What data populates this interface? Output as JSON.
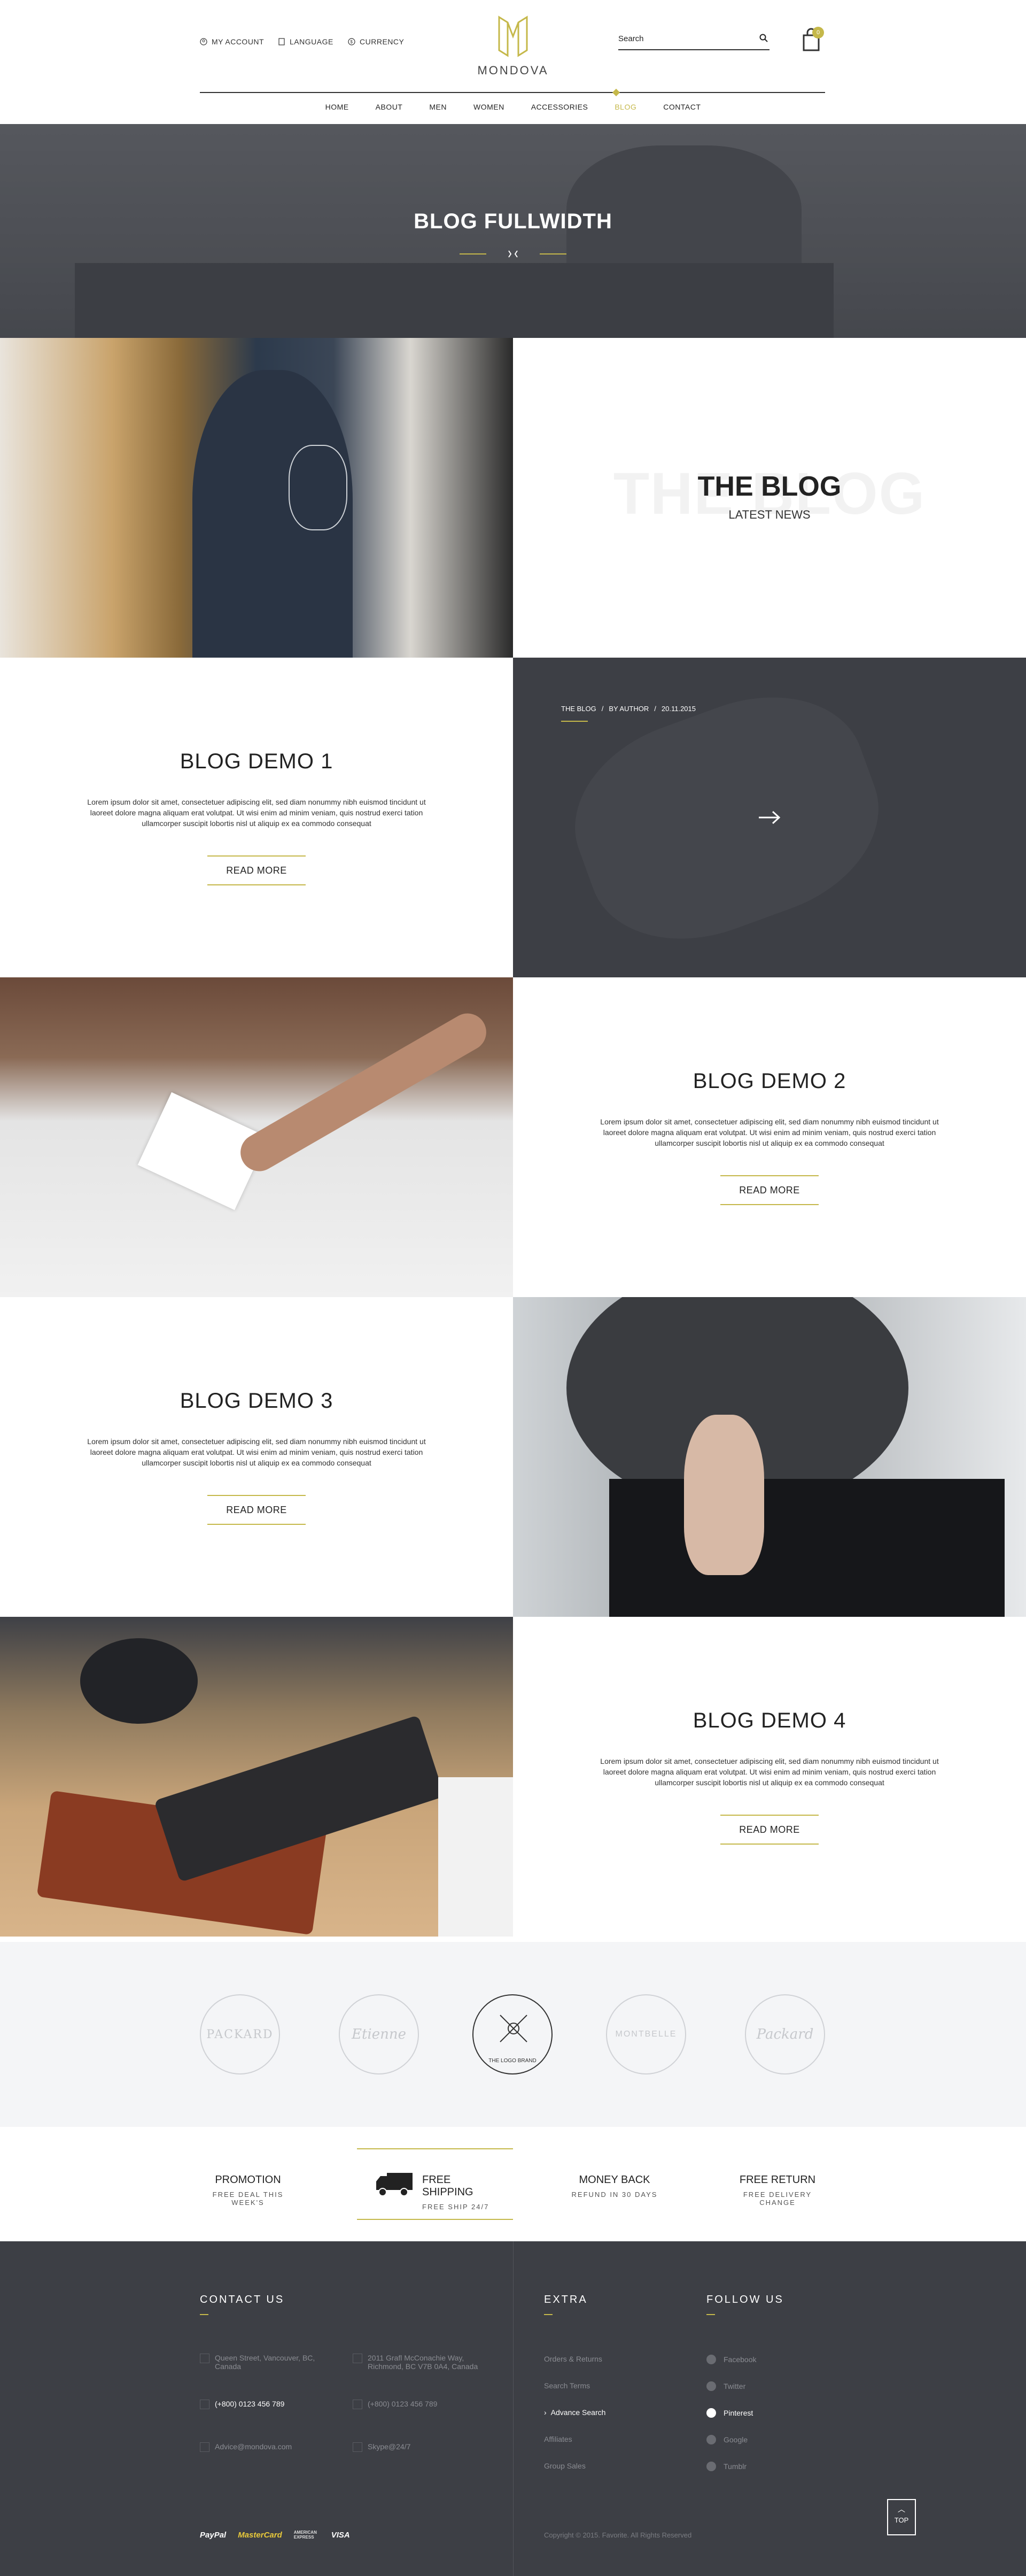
{
  "header": {
    "account": "MY ACCOUNT",
    "language": "LANGUAGE",
    "currency": "CURRENCY",
    "brand": "MONDOVA",
    "search_placeholder": "Search",
    "cart_count": "0",
    "nav": [
      "HOME",
      "ABOUT",
      "MEN",
      "WOMEN",
      "ACCESSORIES",
      "BLOG",
      "CONTACT"
    ],
    "active_nav": "BLOG"
  },
  "hero": {
    "title": "BLOG FULLWIDTH"
  },
  "blog_intro": {
    "bg_text": "THE BLOG",
    "title": "THE BLOG",
    "subtitle": "LATEST NEWS"
  },
  "posts": [
    {
      "title": "BLOG DEMO 1",
      "text": "Lorem ipsum dolor sit amet, consectetuer adipiscing elit, sed diam nonummy nibh euismod tincidunt ut laoreet dolore magna aliquam erat volutpat. Ut wisi enim ad minim veniam, quis nostrud exerci tation ullamcorper suscipit lobortis nisl ut aliquip ex ea commodo consequat",
      "read_more": "READ MORE"
    },
    {
      "title": "BLOG DEMO 2",
      "text": "Lorem ipsum dolor sit amet, consectetuer adipiscing elit, sed diam nonummy nibh euismod tincidunt ut laoreet dolore magna aliquam erat volutpat. Ut wisi enim ad minim veniam, quis nostrud exerci tation ullamcorper suscipit lobortis nisl ut aliquip ex ea commodo consequat",
      "read_more": "READ MORE"
    },
    {
      "title": "BLOG DEMO 3",
      "text": "Lorem ipsum dolor sit amet, consectetuer adipiscing elit, sed diam nonummy nibh euismod tincidunt ut laoreet dolore magna aliquam erat volutpat. Ut wisi enim ad minim veniam, quis nostrud exerci tation ullamcorper suscipit lobortis nisl ut aliquip ex ea commodo consequat",
      "read_more": "READ MORE"
    },
    {
      "title": "BLOG DEMO 4",
      "text": "Lorem ipsum dolor sit amet, consectetuer adipiscing elit, sed diam nonummy nibh euismod tincidunt ut laoreet dolore magna aliquam erat volutpat. Ut wisi enim ad minim veniam, quis nostrud exerci tation ullamcorper suscipit lobortis nisl ut aliquip ex ea commodo consequat",
      "read_more": "READ MORE"
    }
  ],
  "post_meta": {
    "category": "THE BLOG",
    "sep": "/",
    "author": "BY AUTHOR",
    "date": "20.11.2015"
  },
  "brands": [
    "PACKARD",
    "Etienne",
    "THE LOGO BRAND",
    "MONTBELLE",
    "Packard"
  ],
  "features": [
    {
      "title": "PROMOTION",
      "sub": "FREE DEAL THIS WEEK'S"
    },
    {
      "title": "FREE SHIPPING",
      "sub": "FREE SHIP 24/7"
    },
    {
      "title": "MONEY BACK",
      "sub": "REFUND IN 30 DAYS"
    },
    {
      "title": "FREE RETURN",
      "sub": "FREE DELIVERY CHANGE"
    }
  ],
  "footer": {
    "contact_heading": "CONTACT US",
    "address1": "Queen Street, Vancouver, BC, Canada",
    "address2": "2011 Grafl McConachie Way, Richmond, BC V7B 0A4, Canada",
    "phone1": "(+800) 0123 456 789",
    "phone2": "(+800) 0123 456 789",
    "email": "Advice@mondova.com",
    "skype": "Skype@24/7",
    "extra_heading": "EXTRA",
    "extra": [
      "Orders & Returns",
      "Search Terms",
      "Advance Search",
      "Affiliates",
      "Group Sales"
    ],
    "extra_active": "Advance Search",
    "follow_heading": "FOLLOW US",
    "follow": [
      "Facebook",
      "Twitter",
      "Pinterest",
      "Google",
      "Tumblr"
    ],
    "follow_active": "Pinterest",
    "payments": [
      "PayPal",
      "MasterCard",
      "AMERICAN EXPRESS",
      "VISA"
    ],
    "copyright": "Copyright © 2015. Favorite. All Rights Reserved",
    "top_label": "TOP"
  },
  "colors": {
    "accent": "#c5b84a",
    "dark": "#3d3f45",
    "light": "#f4f5f7"
  }
}
